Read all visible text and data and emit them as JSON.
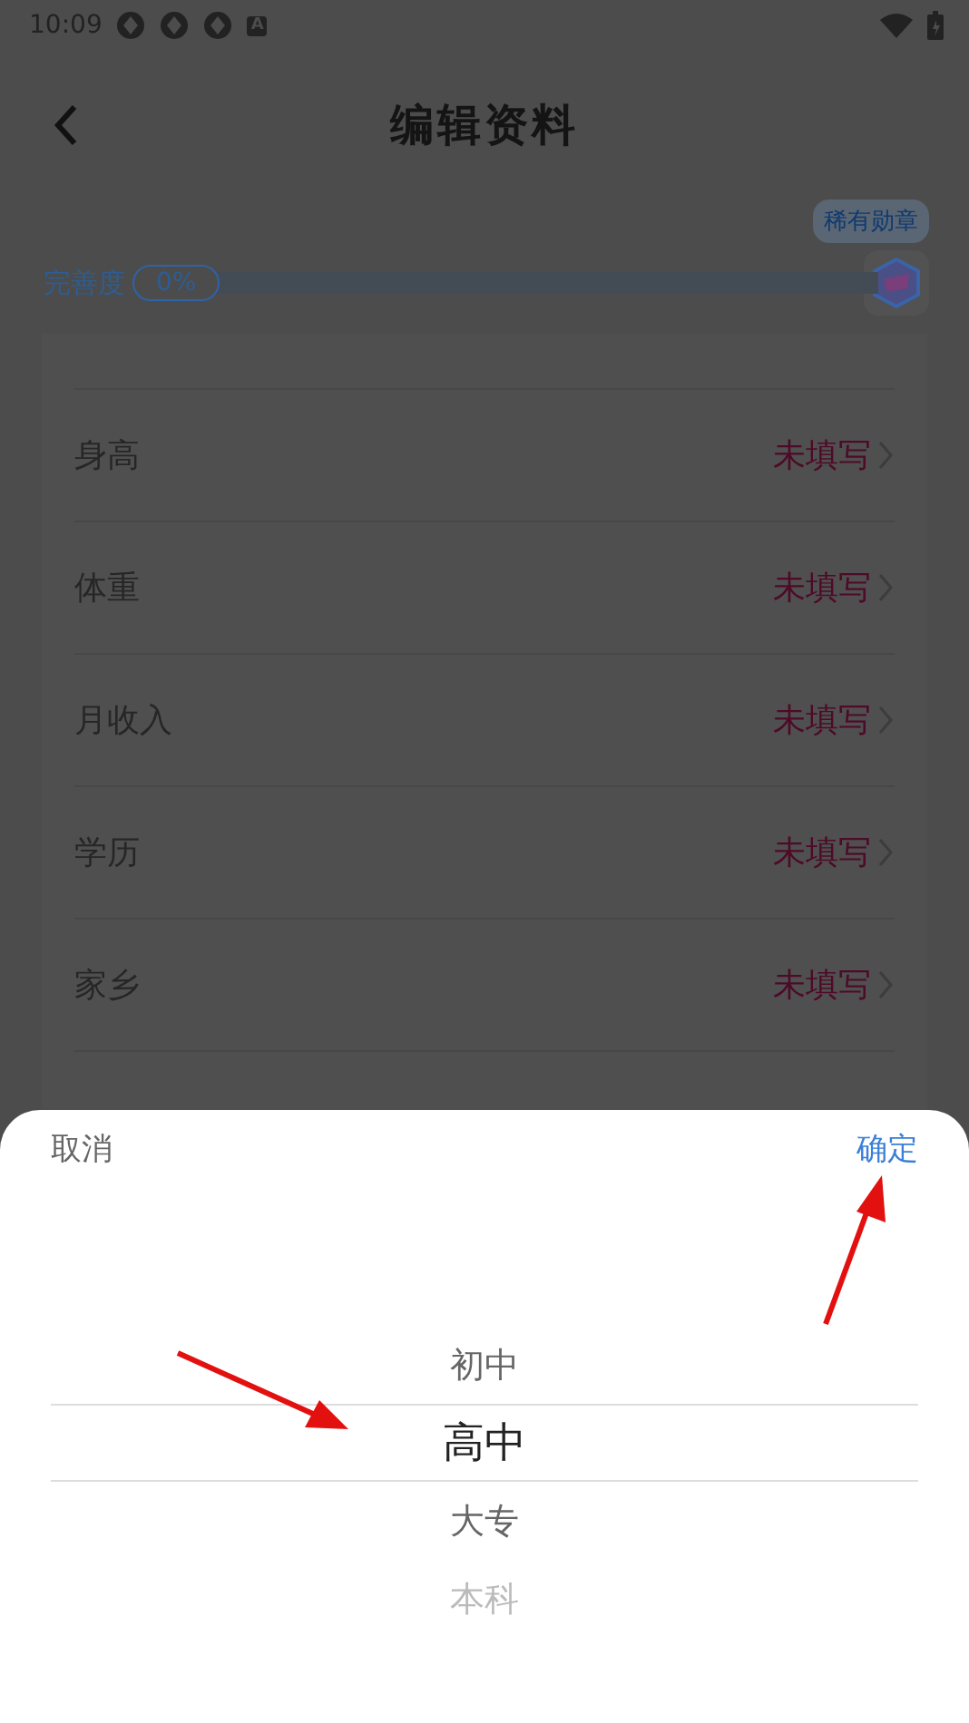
{
  "status_bar": {
    "time": "10:09",
    "notification_letter": "A"
  },
  "header": {
    "title": "编辑资料"
  },
  "badge": {
    "label": "稀有勋章"
  },
  "completion": {
    "label": "完善度",
    "percent": "0%",
    "level": 0
  },
  "rows": [
    {
      "label": "身高",
      "value": "未填写"
    },
    {
      "label": "体重",
      "value": "未填写"
    },
    {
      "label": "月收入",
      "value": "未填写"
    },
    {
      "label": "学历",
      "value": "未填写"
    },
    {
      "label": "家乡",
      "value": "未填写"
    }
  ],
  "picker": {
    "cancel": "取消",
    "confirm": "确定",
    "options": [
      {
        "label": "初中",
        "selected": false
      },
      {
        "label": "高中",
        "selected": true
      },
      {
        "label": "大专",
        "selected": false
      },
      {
        "label": "本科",
        "selected": false
      }
    ]
  }
}
